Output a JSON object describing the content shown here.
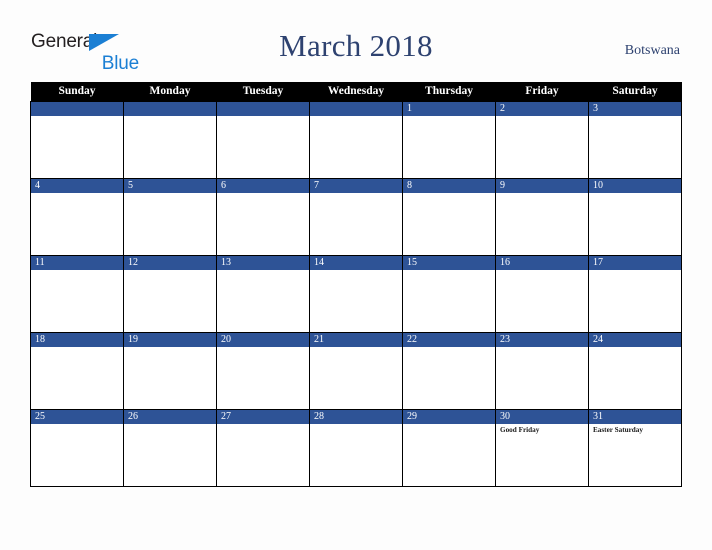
{
  "brand": {
    "name_part1": "General",
    "name_part2": "Blue",
    "triangle_icon": "triangle-icon",
    "color_dark": "#231f20",
    "color_blue": "#1b7fd4"
  },
  "header": {
    "title": "March 2018",
    "country": "Botswana",
    "title_color": "#2e4270"
  },
  "calendar": {
    "weekday_headers": [
      "Sunday",
      "Monday",
      "Tuesday",
      "Wednesday",
      "Thursday",
      "Friday",
      "Saturday"
    ],
    "header_bg": "#000000",
    "header_fg": "#ffffff",
    "daybar_bg": "#2e5396",
    "daybar_fg": "#ffffff",
    "cell_bg": "#ffffff",
    "grid_color": "#000000",
    "weeks": [
      [
        {
          "day": "",
          "events": []
        },
        {
          "day": "",
          "events": []
        },
        {
          "day": "",
          "events": []
        },
        {
          "day": "",
          "events": []
        },
        {
          "day": "1",
          "events": []
        },
        {
          "day": "2",
          "events": []
        },
        {
          "day": "3",
          "events": []
        }
      ],
      [
        {
          "day": "4",
          "events": []
        },
        {
          "day": "5",
          "events": []
        },
        {
          "day": "6",
          "events": []
        },
        {
          "day": "7",
          "events": []
        },
        {
          "day": "8",
          "events": []
        },
        {
          "day": "9",
          "events": []
        },
        {
          "day": "10",
          "events": []
        }
      ],
      [
        {
          "day": "11",
          "events": []
        },
        {
          "day": "12",
          "events": []
        },
        {
          "day": "13",
          "events": []
        },
        {
          "day": "14",
          "events": []
        },
        {
          "day": "15",
          "events": []
        },
        {
          "day": "16",
          "events": []
        },
        {
          "day": "17",
          "events": []
        }
      ],
      [
        {
          "day": "18",
          "events": []
        },
        {
          "day": "19",
          "events": []
        },
        {
          "day": "20",
          "events": []
        },
        {
          "day": "21",
          "events": []
        },
        {
          "day": "22",
          "events": []
        },
        {
          "day": "23",
          "events": []
        },
        {
          "day": "24",
          "events": []
        }
      ],
      [
        {
          "day": "25",
          "events": []
        },
        {
          "day": "26",
          "events": []
        },
        {
          "day": "27",
          "events": []
        },
        {
          "day": "28",
          "events": []
        },
        {
          "day": "29",
          "events": []
        },
        {
          "day": "30",
          "events": [
            "Good Friday"
          ]
        },
        {
          "day": "31",
          "events": [
            "Easter Saturday"
          ]
        }
      ]
    ]
  }
}
